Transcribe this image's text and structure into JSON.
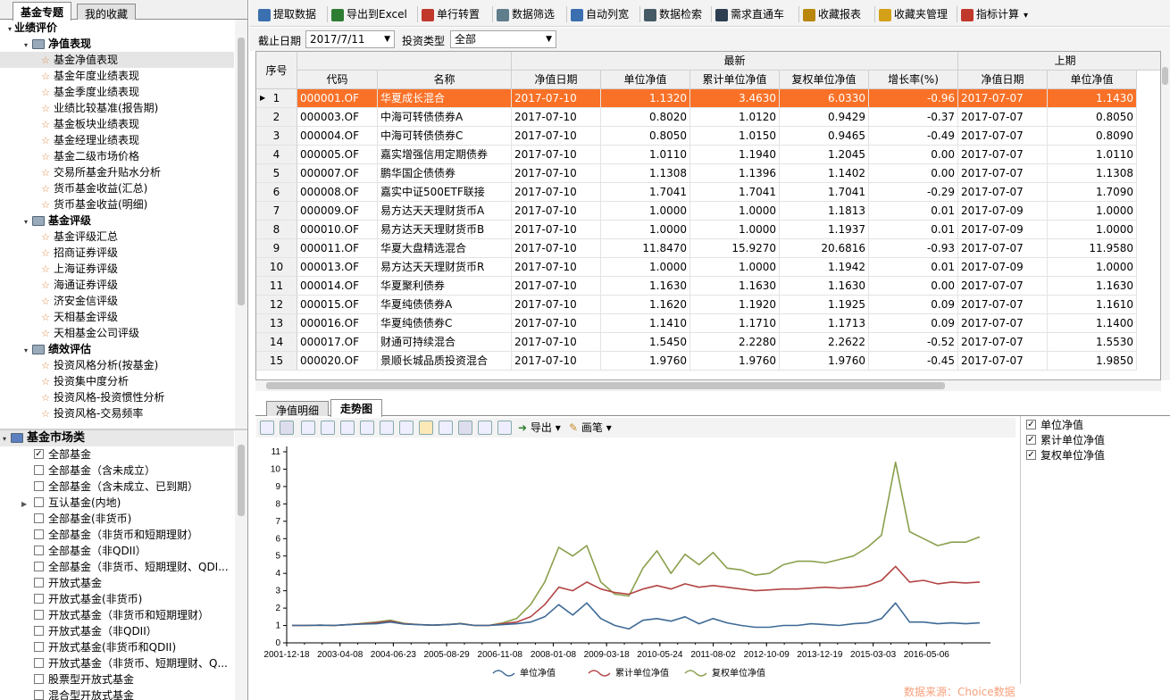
{
  "left_tabs": [
    "基金专题",
    "我的收藏"
  ],
  "tree": [
    {
      "level": 0,
      "label": "业绩评价",
      "type": "group"
    },
    {
      "level": 1,
      "label": "净值表现",
      "type": "folder"
    },
    {
      "level": 2,
      "label": "基金净值表现",
      "type": "item",
      "selected": true
    },
    {
      "level": 2,
      "label": "基金年度业绩表现",
      "type": "item"
    },
    {
      "level": 2,
      "label": "基金季度业绩表现",
      "type": "item"
    },
    {
      "level": 2,
      "label": "业绩比较基准(报告期)",
      "type": "item"
    },
    {
      "level": 2,
      "label": "基金板块业绩表现",
      "type": "item"
    },
    {
      "level": 2,
      "label": "基金经理业绩表现",
      "type": "item"
    },
    {
      "level": 2,
      "label": "基金二级市场价格",
      "type": "item"
    },
    {
      "level": 2,
      "label": "交易所基金升贴水分析",
      "type": "item"
    },
    {
      "level": 2,
      "label": "货币基金收益(汇总)",
      "type": "item"
    },
    {
      "level": 2,
      "label": "货币基金收益(明细)",
      "type": "item"
    },
    {
      "level": 1,
      "label": "基金评级",
      "type": "folder"
    },
    {
      "level": 2,
      "label": "基金评级汇总",
      "type": "item"
    },
    {
      "level": 2,
      "label": "招商证券评级",
      "type": "item"
    },
    {
      "level": 2,
      "label": "上海证券评级",
      "type": "item"
    },
    {
      "level": 2,
      "label": "海通证券评级",
      "type": "item"
    },
    {
      "level": 2,
      "label": "济安金信评级",
      "type": "item"
    },
    {
      "level": 2,
      "label": "天相基金评级",
      "type": "item"
    },
    {
      "level": 2,
      "label": "天相基金公司评级",
      "type": "item"
    },
    {
      "level": 1,
      "label": "绩效评估",
      "type": "folder"
    },
    {
      "level": 2,
      "label": "投资风格分析(按基金)",
      "type": "item"
    },
    {
      "level": 2,
      "label": "投资集中度分析",
      "type": "item"
    },
    {
      "level": 2,
      "label": "投资风格-投资惯性分析",
      "type": "item"
    },
    {
      "level": 2,
      "label": "投资风格-交易频率",
      "type": "item"
    }
  ],
  "market": {
    "header": "基金市场类",
    "items": [
      {
        "label": "全部基金",
        "checked": true
      },
      {
        "label": "全部基金（含未成立）",
        "checked": false
      },
      {
        "label": "全部基金（含未成立、已到期）",
        "checked": false
      },
      {
        "label": "互认基金(内地)",
        "checked": false,
        "expandable": true
      },
      {
        "label": "全部基金(非货币)",
        "checked": false
      },
      {
        "label": "全部基金（非货币和短期理财）",
        "checked": false
      },
      {
        "label": "全部基金（非QDII）",
        "checked": false
      },
      {
        "label": "全部基金（非货币、短期理财、QDI...",
        "checked": false
      },
      {
        "label": "开放式基金",
        "checked": false
      },
      {
        "label": "开放式基金(非货币)",
        "checked": false
      },
      {
        "label": "开放式基金（非货币和短期理财）",
        "checked": false
      },
      {
        "label": "开放式基金（非QDII）",
        "checked": false
      },
      {
        "label": "开放式基金(非货币和QDII)",
        "checked": false
      },
      {
        "label": "开放式基金（非货币、短期理财、Q...",
        "checked": false
      },
      {
        "label": "股票型开放式基金",
        "checked": false
      },
      {
        "label": "混合型开放式基金",
        "checked": false
      }
    ]
  },
  "toolbar": [
    {
      "label": "提取数据",
      "icon": "extract-icon",
      "color": "#3a6fb0"
    },
    {
      "label": "导出到Excel",
      "icon": "excel-icon",
      "color": "#2e7d32"
    },
    {
      "label": "单行转置",
      "icon": "transpose-icon",
      "color": "#c0392b"
    },
    {
      "label": "数据筛选",
      "icon": "filter-icon",
      "color": "#607d8b"
    },
    {
      "label": "自动列宽",
      "icon": "auto-width-icon",
      "color": "#3a6fb0"
    },
    {
      "label": "数据检索",
      "icon": "search-icon",
      "color": "#455a64"
    },
    {
      "label": "需求直通车",
      "icon": "request-icon",
      "color": "#2c3e50"
    },
    {
      "label": "收藏报表",
      "icon": "bookmark-icon",
      "color": "#b8860b"
    },
    {
      "label": "收藏夹管理",
      "icon": "favorites-manage-icon",
      "color": "#d4a017"
    },
    {
      "label": "指标计算",
      "icon": "calculator-icon",
      "color": "#c0392b",
      "dropdown": "▾"
    }
  ],
  "filter": {
    "date_label": "截止日期",
    "date_value": "2017/7/11",
    "type_label": "投资类型",
    "type_value": "全部"
  },
  "grid": {
    "seq_header": "序号",
    "group_latest": "最新",
    "group_prev": "上期",
    "columns": [
      "代码",
      "名称",
      "净值日期",
      "单位净值",
      "累计单位净值",
      "复权单位净值",
      "增长率(%)",
      "净值日期",
      "单位净值"
    ],
    "rows": [
      [
        "1",
        "000001.OF",
        "华夏成长混合",
        "2017-07-10",
        "1.1320",
        "3.4630",
        "6.0330",
        "-0.96",
        "2017-07-07",
        "1.1430"
      ],
      [
        "2",
        "000003.OF",
        "中海可转债债券A",
        "2017-07-10",
        "0.8020",
        "1.0120",
        "0.9429",
        "-0.37",
        "2017-07-07",
        "0.8050"
      ],
      [
        "3",
        "000004.OF",
        "中海可转债债券C",
        "2017-07-10",
        "0.8050",
        "1.0150",
        "0.9465",
        "-0.49",
        "2017-07-07",
        "0.8090"
      ],
      [
        "4",
        "000005.OF",
        "嘉实增强信用定期债券",
        "2017-07-10",
        "1.0110",
        "1.1940",
        "1.2045",
        "0.00",
        "2017-07-07",
        "1.0110"
      ],
      [
        "5",
        "000007.OF",
        "鹏华国企债债券",
        "2017-07-10",
        "1.1308",
        "1.1396",
        "1.1402",
        "0.00",
        "2017-07-07",
        "1.1308"
      ],
      [
        "6",
        "000008.OF",
        "嘉实中证500ETF联接",
        "2017-07-10",
        "1.7041",
        "1.7041",
        "1.7041",
        "-0.29",
        "2017-07-07",
        "1.7090"
      ],
      [
        "7",
        "000009.OF",
        "易方达天天理财货币A",
        "2017-07-10",
        "1.0000",
        "1.0000",
        "1.1813",
        "0.01",
        "2017-07-09",
        "1.0000"
      ],
      [
        "8",
        "000010.OF",
        "易方达天天理财货币B",
        "2017-07-10",
        "1.0000",
        "1.0000",
        "1.1937",
        "0.01",
        "2017-07-09",
        "1.0000"
      ],
      [
        "9",
        "000011.OF",
        "华夏大盘精选混合",
        "2017-07-10",
        "11.8470",
        "15.9270",
        "20.6816",
        "-0.93",
        "2017-07-07",
        "11.9580"
      ],
      [
        "10",
        "000013.OF",
        "易方达天天理财货币R",
        "2017-07-10",
        "1.0000",
        "1.0000",
        "1.1942",
        "0.01",
        "2017-07-09",
        "1.0000"
      ],
      [
        "11",
        "000014.OF",
        "华夏聚利债券",
        "2017-07-10",
        "1.1630",
        "1.1630",
        "1.1630",
        "0.00",
        "2017-07-07",
        "1.1630"
      ],
      [
        "12",
        "000015.OF",
        "华夏纯债债券A",
        "2017-07-10",
        "1.1620",
        "1.1920",
        "1.1925",
        "0.09",
        "2017-07-07",
        "1.1610"
      ],
      [
        "13",
        "000016.OF",
        "华夏纯债债券C",
        "2017-07-10",
        "1.1410",
        "1.1710",
        "1.1713",
        "0.09",
        "2017-07-07",
        "1.1400"
      ],
      [
        "14",
        "000017.OF",
        "财通可持续混合",
        "2017-07-10",
        "1.5450",
        "2.2280",
        "2.2622",
        "-0.52",
        "2017-07-07",
        "1.5530"
      ],
      [
        "15",
        "000020.OF",
        "景顺长城品质投资混合",
        "2017-07-10",
        "1.9760",
        "1.9760",
        "1.9760",
        "-0.45",
        "2017-07-07",
        "1.9850"
      ]
    ],
    "highlight_row": 0
  },
  "bottom_tabs": [
    "净值明细",
    "走势图"
  ],
  "chart_toolbar": {
    "export_label": "导出",
    "pen_label": "画笔",
    "dropdown": "▾"
  },
  "legend_checks": [
    {
      "label": "单位净值",
      "checked": true
    },
    {
      "label": "累计单位净值",
      "checked": true
    },
    {
      "label": "复权单位净值",
      "checked": true
    }
  ],
  "source": "数据来源：Choice数据",
  "chart_data": {
    "type": "line",
    "xticks": [
      "2001-12-18",
      "2003-04-08",
      "2004-06-23",
      "2005-08-29",
      "2006-11-08",
      "2008-01-08",
      "2009-03-18",
      "2010-05-24",
      "2011-08-02",
      "2012-10-09",
      "2013-12-19",
      "2015-03-03",
      "2016-05-06"
    ],
    "yticks": [
      0,
      1,
      2,
      3,
      4,
      5,
      6,
      7,
      8,
      9,
      10,
      11
    ],
    "ylim": [
      0,
      11
    ],
    "legend_position": "bottom",
    "series": [
      {
        "name": "单位净值",
        "color": "#3e6a96",
        "values": [
          1.0,
          1.0,
          1.02,
          1.0,
          1.05,
          1.08,
          1.1,
          1.2,
          1.08,
          1.05,
          1.02,
          1.05,
          1.1,
          1.0,
          1.0,
          1.05,
          1.1,
          1.2,
          1.5,
          2.2,
          1.6,
          2.3,
          1.4,
          1.0,
          0.8,
          1.3,
          1.4,
          1.25,
          1.5,
          1.1,
          1.4,
          1.15,
          1.0,
          0.9,
          0.9,
          1.0,
          1.0,
          1.1,
          1.05,
          1.0,
          1.1,
          1.15,
          1.4,
          2.3,
          1.2,
          1.2,
          1.1,
          1.15,
          1.1,
          1.15
        ]
      },
      {
        "name": "累计单位净值",
        "color": "#b34444",
        "values": [
          1.0,
          1.0,
          1.02,
          1.0,
          1.05,
          1.1,
          1.15,
          1.25,
          1.1,
          1.05,
          1.02,
          1.05,
          1.1,
          1.0,
          1.0,
          1.1,
          1.2,
          1.5,
          2.2,
          3.2,
          3.0,
          3.5,
          3.1,
          2.9,
          2.8,
          3.1,
          3.3,
          3.1,
          3.4,
          3.2,
          3.3,
          3.2,
          3.1,
          3.0,
          3.05,
          3.1,
          3.1,
          3.15,
          3.2,
          3.15,
          3.2,
          3.3,
          3.6,
          4.4,
          3.5,
          3.6,
          3.4,
          3.5,
          3.45,
          3.5
        ]
      },
      {
        "name": "复权单位净值",
        "color": "#8aa04c",
        "values": [
          1.0,
          1.0,
          1.02,
          1.0,
          1.05,
          1.12,
          1.2,
          1.3,
          1.12,
          1.05,
          1.02,
          1.05,
          1.12,
          1.0,
          1.0,
          1.15,
          1.4,
          2.2,
          3.5,
          5.5,
          5.0,
          5.6,
          3.5,
          2.8,
          2.7,
          4.3,
          5.3,
          4.0,
          5.1,
          4.5,
          5.2,
          4.3,
          4.2,
          3.9,
          4.0,
          4.5,
          4.7,
          4.7,
          4.6,
          4.8,
          5.0,
          5.5,
          6.2,
          10.4,
          6.4,
          6.0,
          5.6,
          5.8,
          5.8,
          6.1
        ]
      }
    ]
  }
}
